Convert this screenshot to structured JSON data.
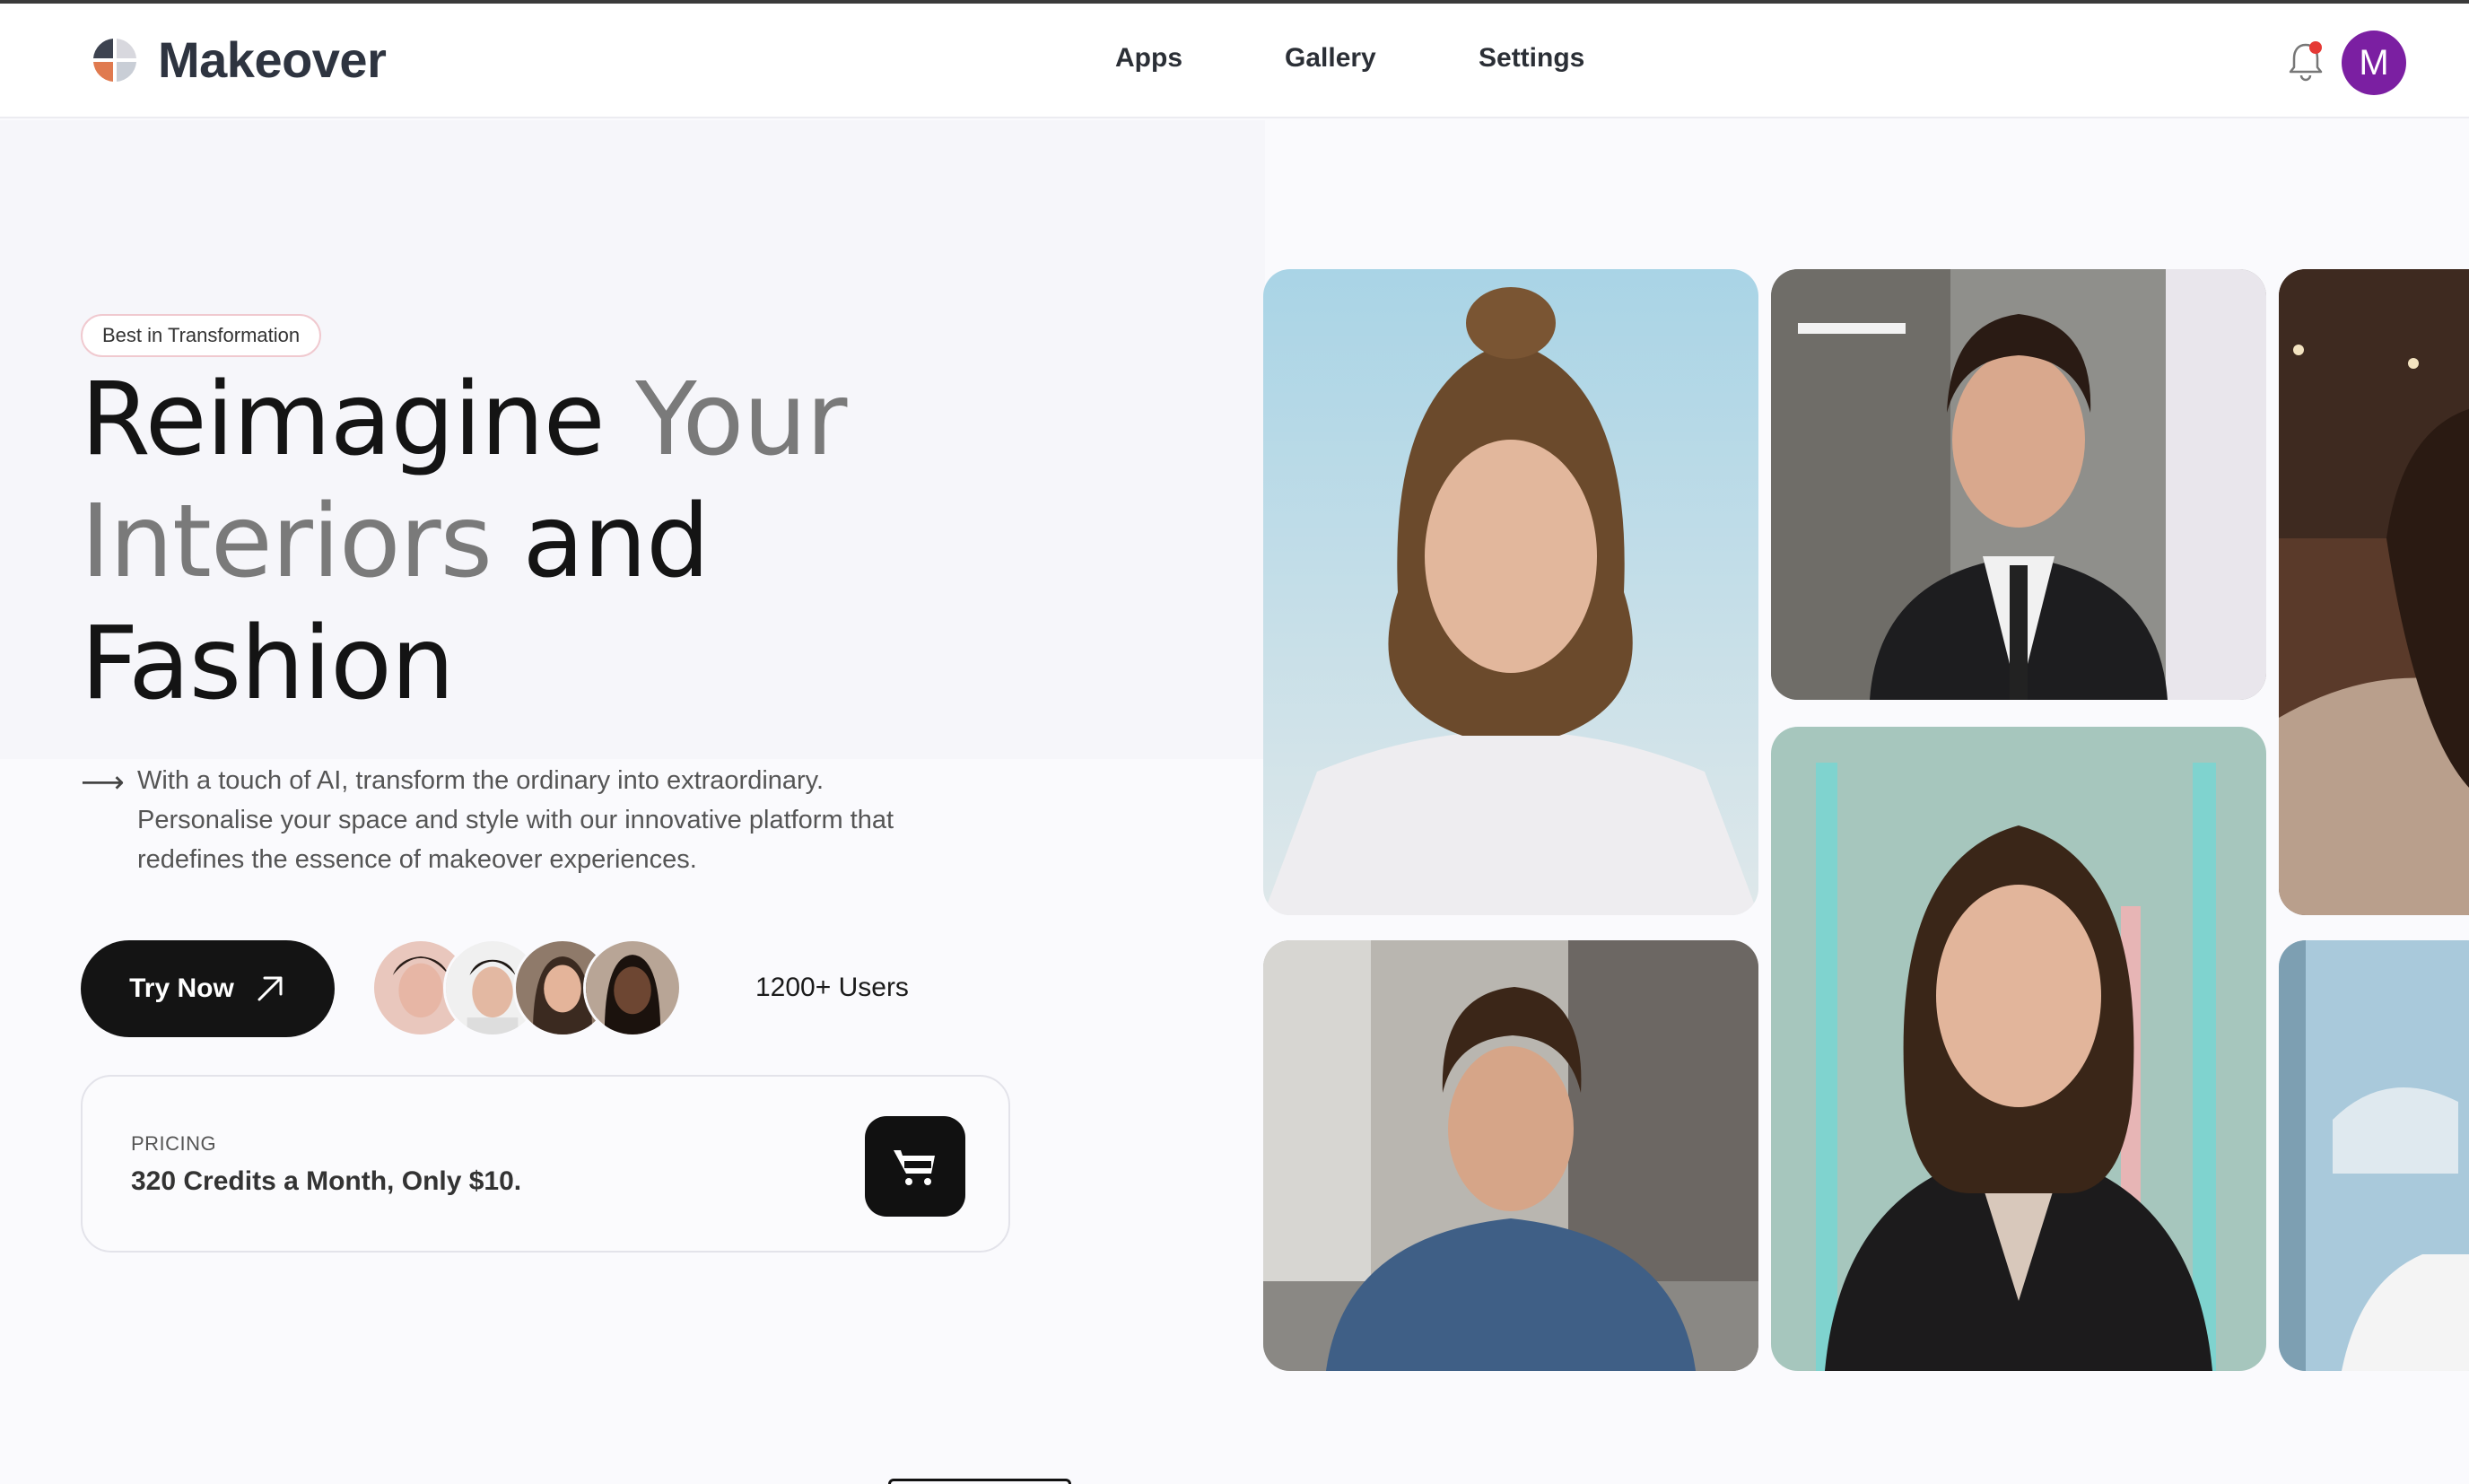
{
  "app": {
    "name": "Makeover"
  },
  "nav": {
    "items": [
      {
        "label": "Apps"
      },
      {
        "label": "Gallery"
      },
      {
        "label": "Settings"
      }
    ]
  },
  "user": {
    "initial": "M",
    "avatar_color": "#7b1fa2",
    "has_notification": true
  },
  "hero": {
    "badge": "Best in Transformation",
    "headline": {
      "w1": "Reimagine",
      "w2": "Your",
      "w3": "Interiors",
      "w4": "and",
      "w5": "Fashion"
    },
    "description": "With a touch of AI, transform the ordinary into extraordinary. Personalise your space and style with our innovative platform that redefines the essence of makeover experiences.",
    "cta_label": "Try Now",
    "users_count": "1200+ Users"
  },
  "pricing": {
    "label": "PRICING",
    "text": "320 Credits a Month, Only $10."
  },
  "colors": {
    "dark": "#141414",
    "muted_text": "#7a7a7a",
    "notification": "#e53935"
  }
}
